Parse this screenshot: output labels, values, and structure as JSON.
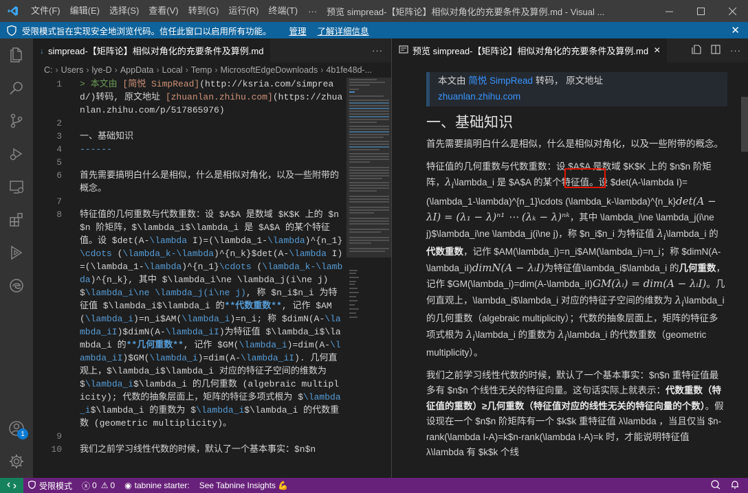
{
  "titlebar": {
    "menu": [
      "文件(F)",
      "编辑(E)",
      "选择(S)",
      "查看(V)",
      "转到(G)",
      "运行(R)",
      "终端(T)"
    ],
    "more": "···",
    "title": "预览 simpread-【矩阵论】相似对角化的充要条件及算例.md - Visual ..."
  },
  "banner": {
    "message": "受限模式旨在实现安全地浏览代码。信任此窗口以启用所有功能。",
    "manage": "管理",
    "learn_more": "了解详细信息"
  },
  "left_editor": {
    "tab_label": "simpread-【矩阵论】相似对角化的充要条件及算例.md",
    "tab_icon": "↓",
    "more": "···",
    "breadcrumb": [
      "C:",
      "Users",
      "lye-D",
      "AppData",
      "Local",
      "Temp",
      "MicrosoftEdgeDownloads",
      "4b1fe48d-..."
    ]
  },
  "code_lines": [
    {
      "n": "1",
      "segs": [
        [
          "c-quote",
          "> 本文由 "
        ],
        [
          "c-link",
          "[简悦 SimpRead]"
        ],
        [
          "c-url",
          "(http://ksria.com/simpread/)"
        ],
        [
          "",
          "转码, 原文地址 "
        ],
        [
          "c-link",
          "[zhuanlan.zhihu.com]"
        ],
        [
          "c-url",
          "(https://zhuanlan.zhihu.com/p/517865976)"
        ]
      ]
    },
    {
      "n": "2",
      "segs": [
        [
          "",
          ""
        ]
      ]
    },
    {
      "n": "3",
      "segs": [
        [
          "",
          "一、基础知识"
        ]
      ]
    },
    {
      "n": "4",
      "segs": [
        [
          "c-head",
          "------"
        ]
      ]
    },
    {
      "n": "5",
      "segs": [
        [
          "",
          ""
        ]
      ]
    },
    {
      "n": "6",
      "segs": [
        [
          "",
          "首先需要搞明白什么是相似，什么是相似对角化，以及一些附带的概念。"
        ]
      ]
    },
    {
      "n": "7",
      "segs": [
        [
          "",
          ""
        ]
      ]
    },
    {
      "n": "8",
      "segs": [
        [
          "",
          "特征值的几何重数与代数重数：设 $A$A 是数域 $K$K 上的 $n$n 阶矩阵，$\\lambda_i$\\lambda_i 是 $A$A 的某个特征值。设 $det(A-"
        ],
        [
          "c-kw",
          "\\lambda"
        ],
        [
          "",
          " I)=(\\lambda_1-"
        ],
        [
          "c-kw",
          "\\lambda"
        ],
        [
          "",
          ")^{n_1}"
        ],
        [
          "c-kw",
          "\\cdots"
        ],
        [
          "",
          " ("
        ],
        [
          "c-kw",
          "\\lambda_k-\\lambda"
        ],
        [
          "",
          ")^{n_k}$det(A-"
        ],
        [
          "c-kw",
          "\\lambda"
        ],
        [
          "",
          " I)=(\\lambda_1-"
        ],
        [
          "c-kw",
          "\\lambda"
        ],
        [
          "",
          ")^{n_1}"
        ],
        [
          "c-kw",
          "\\cdots"
        ],
        [
          "",
          " ("
        ],
        [
          "c-kw",
          "\\lambda_k-\\lambda"
        ],
        [
          "",
          ")^{n_k}, 其中 $\\lambda_i\\ne \\lambda_j(i\\ne j)$"
        ],
        [
          "c-kw",
          "\\lambda_i\\ne \\lambda_j(i\\ne j)"
        ],
        [
          "",
          ", 称 $n_i$n_i 为特征值 $\\lambda_i$\\lambda_i 的"
        ],
        [
          "c-bold",
          "**代数重数**"
        ],
        [
          "",
          ", 记作 $AM("
        ],
        [
          "c-kw",
          "\\lambda_i"
        ],
        [
          "",
          ")=n_i$AM("
        ],
        [
          "c-kw",
          "\\lambda_i"
        ],
        [
          "",
          ")=n_i; 称 $dimN(A-"
        ],
        [
          "c-kw",
          "\\lambda_iI"
        ],
        [
          "",
          ")$dimN(A-"
        ],
        [
          "c-kw",
          "\\lambda_iI"
        ],
        [
          "",
          ")为特征值 $\\lambda_i$\\lambda_i 的"
        ],
        [
          "c-bold",
          "**几何重数**"
        ],
        [
          "",
          ", 记作 $GM("
        ],
        [
          "c-kw",
          "\\lambda_i"
        ],
        [
          "",
          ")=dim(A-"
        ],
        [
          "c-kw",
          "\\lambda_iI"
        ],
        [
          "",
          ")$GM("
        ],
        [
          "c-kw",
          "\\lambda_i"
        ],
        [
          "",
          ")=dim(A-"
        ],
        [
          "c-kw",
          "\\lambda_iI"
        ],
        [
          "",
          "). 几何直观上，$\\lambda_i$\\lambda_i 对应的特征子空间的维数为 $"
        ],
        [
          "c-kw",
          "\\lambda_i"
        ],
        [
          "",
          "$\\lambda_i 的几何重数 (algebraic multiplicity); 代数的抽象层面上，矩阵的特征多项式根为 $"
        ],
        [
          "c-kw",
          "\\lambda_i"
        ],
        [
          "",
          "$\\lambda_i 的重数为 $"
        ],
        [
          "c-kw",
          "\\lambda_i"
        ],
        [
          "",
          "$\\lambda_i 的代数重数 (geometric multiplicity)。"
        ]
      ]
    },
    {
      "n": "9",
      "segs": [
        [
          "",
          ""
        ]
      ]
    },
    {
      "n": "10",
      "segs": [
        [
          "",
          "我们之前学习线性代数的时候，默认了一个基本事实：$n$n"
        ]
      ]
    }
  ],
  "right_editor": {
    "tab_label": "预览 simpread-【矩阵论】相似对角化的充要条件及算例.md",
    "close": "×"
  },
  "preview": {
    "quote_prefix": "本文由 ",
    "quote_link": "简悦 SimpRead",
    "quote_mid": " 转码， 原文地址",
    "quote_link2": "zhuanlan.zhihu.com",
    "h1": "一、基础知识",
    "p1": "首先需要搞明白什么是相似，什么是相似对角化，以及一些附带的概念。",
    "p2_a": "特征值的几何重数与代数重数：设 $A$A 是数域 $K$K 上的 $n$n 阶矩阵，",
    "p2_b": "λ",
    "p2_c": "\\lambda_i 是 $A$A 的某个特征值。设 $det(A-\\lambda I)=(\\lambda_1-\\lambda)^{n_1}\\cdots (\\lambda_k-\\lambda)^{n_k}",
    "p2_math1": "det(A − λI) = (λ₁ − λ)ⁿ¹ ⋯ (λₖ − λ)ⁿᵏ",
    "p2_d": "，其中 \\lambda_i\\ne \\lambda_j(i\\ne j)$\\lambda_i\\ne \\lambda_j(i\\ne j)，称 $n_i$n_i 为特征值 ",
    "p2_e": "\\lambda_i 的",
    "p2_bold1": "代数重数",
    "p2_f": "，记作 $AM(\\lambda_i)=n_i$AM(\\lambda_i)=n_i；称 $dimN(A-\\lambda_iI)",
    "p2_math2": "dimN(A − λᵢI)",
    "p2_g": "为特征值\\lambda_i$\\lambda_i 的",
    "p2_bold2": "几何重数",
    "p2_h": "，记作 $GM(\\lambda_i)=dim(A-\\lambda_iI)",
    "p2_math3": "GM(λᵢ) = dim(A − λᵢI)",
    "p2_i": "。几何直观上，\\lambda_i$\\lambda_i 对应的特征子空间的维数为 ",
    "p2_j": "\\lambda_i 的几何重数（algebraic multiplicity）；代数的抽象层面上，矩阵的特征多项式根为 ",
    "p2_k": "\\lambda_i 的重数为 ",
    "p2_l": "\\lambda_i 的代数重数（geometric multiplicity）。",
    "p3_a": "我们之前学习线性代数的时候，默认了一个基本事实：$n$n 重特征值最多有 $n$n 个线性无关的特征向量。这句话实际上就表示：",
    "p3_bold": "代数重数（特征值的重数）≥几何重数（特征值对应的线性无关的特征向量的个数）",
    "p3_b": "。假设现在一个 $n$n 阶矩阵有一个 $k$k 重特征值 λ\\lambda ，当且仅当 $n-rank(\\lambda I-A)=k$n-rank(\\lambda I-A)=k 时，才能说明特征值 λ\\lambda 有 $k$k 个线"
  },
  "statusbar": {
    "restricted": "受限模式",
    "errors": "0",
    "warnings": "0",
    "tabnine": "tabnine starter:",
    "insights": "See Tabnine Insights 💪"
  },
  "activity": {
    "badge": "1"
  }
}
